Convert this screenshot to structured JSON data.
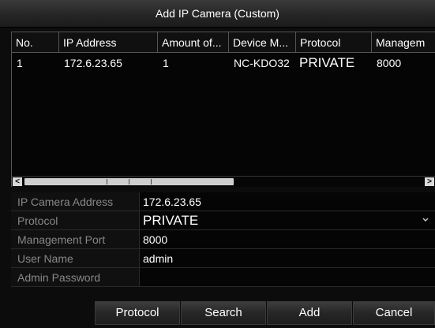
{
  "dialog": {
    "title": "Add IP Camera (Custom)"
  },
  "table": {
    "headers": [
      "No.",
      "IP Address",
      "Amount of...",
      "Device M...",
      "Protocol",
      "Managem"
    ],
    "rows": [
      [
        "1",
        "172.6.23.65",
        "1",
        "NC-KDO32",
        "PRIVATE",
        "8000"
      ]
    ]
  },
  "scrollbar": {
    "left_arrow": "<",
    "right_arrow": ">"
  },
  "form": {
    "ip_label": "IP Camera Address",
    "ip_value": "172.6.23.65",
    "protocol_label": "Protocol",
    "protocol_value": "PRIVATE",
    "port_label": "Management Port",
    "port_value": "8000",
    "user_label": "User Name",
    "user_value": "admin",
    "password_label": "Admin Password",
    "password_value": ""
  },
  "buttons": {
    "protocol": "Protocol",
    "search": "Search",
    "add": "Add",
    "cancel": "Cancel"
  },
  "icons": {
    "dropdown": "chevron-down-icon"
  }
}
